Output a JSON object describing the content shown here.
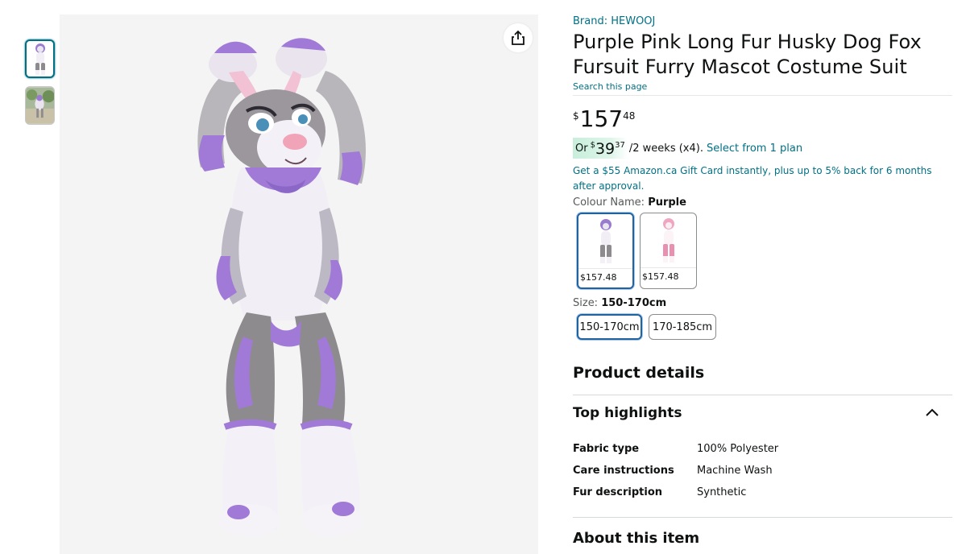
{
  "gallery": {
    "thumbnails": [
      "costume-front",
      "costume-outdoor"
    ],
    "active_index": 0
  },
  "product": {
    "brand": "Brand: HEWOOJ",
    "title": "Purple Pink Long Fur Husky Dog Fox Fursuit Furry Mascot Costume Suit",
    "search_page": "Search this page"
  },
  "price": {
    "symbol": "$",
    "whole": "157",
    "fraction": "48"
  },
  "installment": {
    "or": "Or",
    "symbol": "$",
    "whole": "39",
    "fraction": "37",
    "period": "/2 weeks (x4).",
    "link": "Select from 1 plan"
  },
  "promo": {
    "gift_card": "Get a $55 Amazon.ca Gift Card instantly, plus up to 5% back for 6 months after approval."
  },
  "colour": {
    "label": "Colour Name:",
    "selected": "Purple",
    "options": [
      {
        "price": "$157.48"
      },
      {
        "price": "$157.48"
      }
    ]
  },
  "size": {
    "label": "Size:",
    "selected": "150-170cm",
    "options": [
      "150-170cm",
      "170-185cm"
    ]
  },
  "details": {
    "product_details": "Product details",
    "top_highlights": "Top highlights",
    "specs": [
      {
        "key": "Fabric type",
        "value": "100% Polyester"
      },
      {
        "key": "Care instructions",
        "value": "Machine Wash"
      },
      {
        "key": "Fur description",
        "value": "Synthetic"
      }
    ],
    "about": "About this item"
  },
  "colors": {
    "link": "#007185",
    "selected_border": "#2162a1",
    "installment_bg": "#c8eedb",
    "fur_purple": "#a07ad6",
    "fur_grey": "#8e8b8f",
    "fur_white": "#f3f1f7"
  }
}
